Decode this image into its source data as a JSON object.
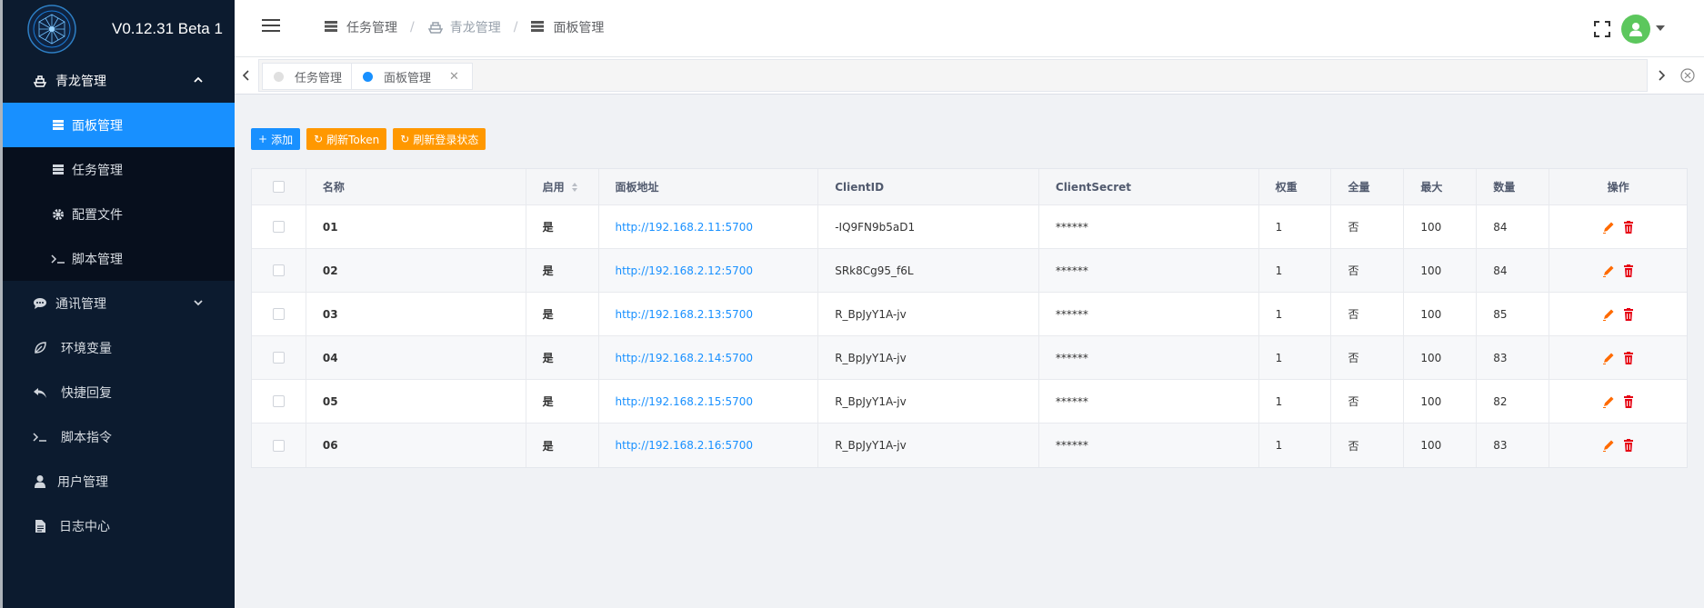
{
  "app": {
    "version": "V0.12.31 Beta 1"
  },
  "sidebar": {
    "groups": [
      {
        "label": "青龙管理",
        "icon": "ship-icon",
        "expanded": true
      },
      {
        "label": "通讯管理",
        "icon": "chat-icon",
        "expanded": false
      }
    ],
    "sub_items": [
      {
        "label": "面板管理",
        "icon": "server-icon",
        "active": true
      },
      {
        "label": "任务管理",
        "icon": "server-icon",
        "active": false
      },
      {
        "label": "配置文件",
        "icon": "gear-icon",
        "active": false
      },
      {
        "label": "脚本管理",
        "icon": "terminal-icon",
        "active": false
      }
    ],
    "items": [
      {
        "label": "环境变量",
        "icon": "leaf-icon"
      },
      {
        "label": "快捷回复",
        "icon": "reply-icon"
      },
      {
        "label": "脚本指令",
        "icon": "terminal-icon"
      },
      {
        "label": "用户管理",
        "icon": "user-icon"
      },
      {
        "label": "日志中心",
        "icon": "file-icon"
      }
    ]
  },
  "breadcrumb": [
    {
      "label": "任务管理",
      "icon": "server-icon"
    },
    {
      "label": "青龙管理",
      "icon": "ship-icon"
    },
    {
      "label": "面板管理",
      "icon": "server-icon"
    }
  ],
  "tabs": [
    {
      "label": "任务管理",
      "active": false
    },
    {
      "label": "面板管理",
      "active": true
    }
  ],
  "toolbar": {
    "add_label": "添加",
    "refresh_token_label": "刷新Token",
    "refresh_login_label": "刷新登录状态"
  },
  "table": {
    "columns": [
      "名称",
      "启用",
      "面板地址",
      "ClientID",
      "ClientSecret",
      "权重",
      "全量",
      "最大",
      "数量",
      "操作"
    ],
    "rows": [
      {
        "name": "01",
        "enabled": "是",
        "url": "http://192.168.2.11:5700",
        "client_id": "-IQ9FN9b5aD1",
        "secret": "******",
        "weight": "1",
        "full": "否",
        "max": "100",
        "count": "84"
      },
      {
        "name": "02",
        "enabled": "是",
        "url": "http://192.168.2.12:5700",
        "client_id": "SRk8Cg95_f6L",
        "secret": "******",
        "weight": "1",
        "full": "否",
        "max": "100",
        "count": "84"
      },
      {
        "name": "03",
        "enabled": "是",
        "url": "http://192.168.2.13:5700",
        "client_id": "R_BpJyY1A-jv",
        "secret": "******",
        "weight": "1",
        "full": "否",
        "max": "100",
        "count": "85"
      },
      {
        "name": "04",
        "enabled": "是",
        "url": "http://192.168.2.14:5700",
        "client_id": "R_BpJyY1A-jv",
        "secret": "******",
        "weight": "1",
        "full": "否",
        "max": "100",
        "count": "83"
      },
      {
        "name": "05",
        "enabled": "是",
        "url": "http://192.168.2.15:5700",
        "client_id": "R_BpJyY1A-jv",
        "secret": "******",
        "weight": "1",
        "full": "否",
        "max": "100",
        "count": "82"
      },
      {
        "name": "06",
        "enabled": "是",
        "url": "http://192.168.2.16:5700",
        "client_id": "R_BpJyY1A-jv",
        "secret": "******",
        "weight": "1",
        "full": "否",
        "max": "100",
        "count": "83"
      }
    ]
  },
  "colors": {
    "primary": "#1890ff",
    "warning": "#ff9800",
    "sidebar_bg": "#0c1b2f",
    "danger": "#e60012",
    "edit": "#ff6a00"
  }
}
